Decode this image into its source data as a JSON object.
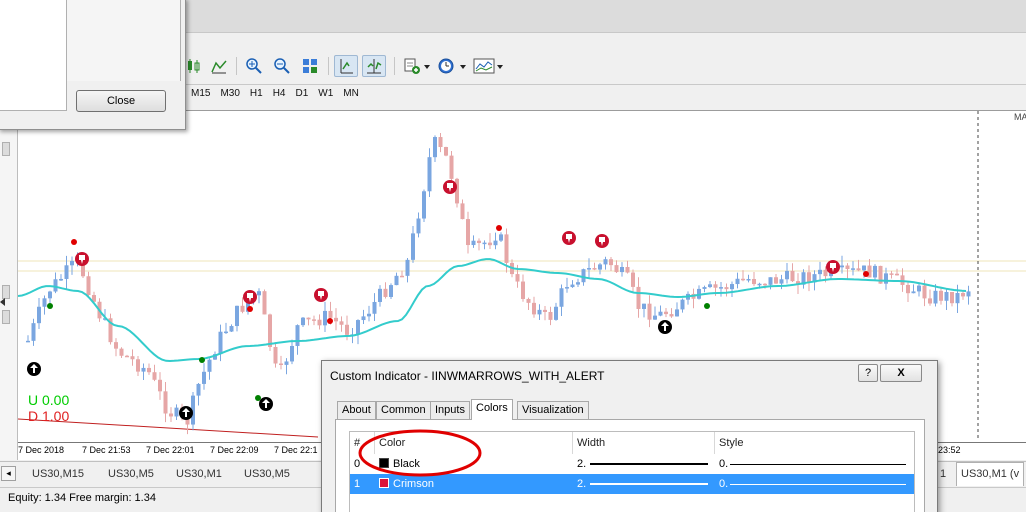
{
  "colors": {
    "bull_candle": "#7aa6e0",
    "bear_candle": "#e6a6a6",
    "ma_line": "#33cccc",
    "down_arrow": "#c8102e",
    "up_arrow": "#000000",
    "dot_red": "#e00000",
    "dot_green": "#008000",
    "selection": "#3399ff",
    "annotation": "#e00000",
    "u_text": "#00cc00",
    "d_text": "#e02020"
  },
  "background_dialog": {
    "close_label": "Close"
  },
  "toolbar": {
    "timeframes": [
      "M15",
      "M30",
      "H1",
      "H4",
      "D1",
      "W1",
      "MN"
    ]
  },
  "chart": {
    "u_label": "U 0.00",
    "d_label": "D 1.00",
    "corner_label": "MA",
    "time_labels": [
      "7 Dec 2018",
      "7 Dec 21:53",
      "7 Dec 22:01",
      "7 Dec 22:09",
      "7 Dec 22:1",
      "23:52"
    ]
  },
  "tabs": {
    "items": [
      "US30,M15",
      "US30,M5",
      "US30,M1",
      "US30,M5",
      "1",
      "US30,M1 (v"
    ]
  },
  "status": {
    "text": "Equity: 1.34  Free margin: 1.34"
  },
  "indicator_dialog": {
    "title": "Custom Indicator - IINWMARROWS_WITH_ALERT",
    "help_label": "?",
    "close_label": "X",
    "tabs": [
      "About",
      "Common",
      "Inputs",
      "Colors",
      "Visualization"
    ],
    "active_tab": "Colors",
    "table": {
      "headers": [
        "#",
        "Color",
        "Width",
        "Style"
      ],
      "rows": [
        {
          "index": "0",
          "color_name": "Black",
          "swatch": "#000000",
          "width": "2.",
          "style": "0."
        },
        {
          "index": "1",
          "color_name": "Crimson",
          "swatch": "#dc143c",
          "width": "2.",
          "style": "0."
        }
      ]
    }
  }
}
